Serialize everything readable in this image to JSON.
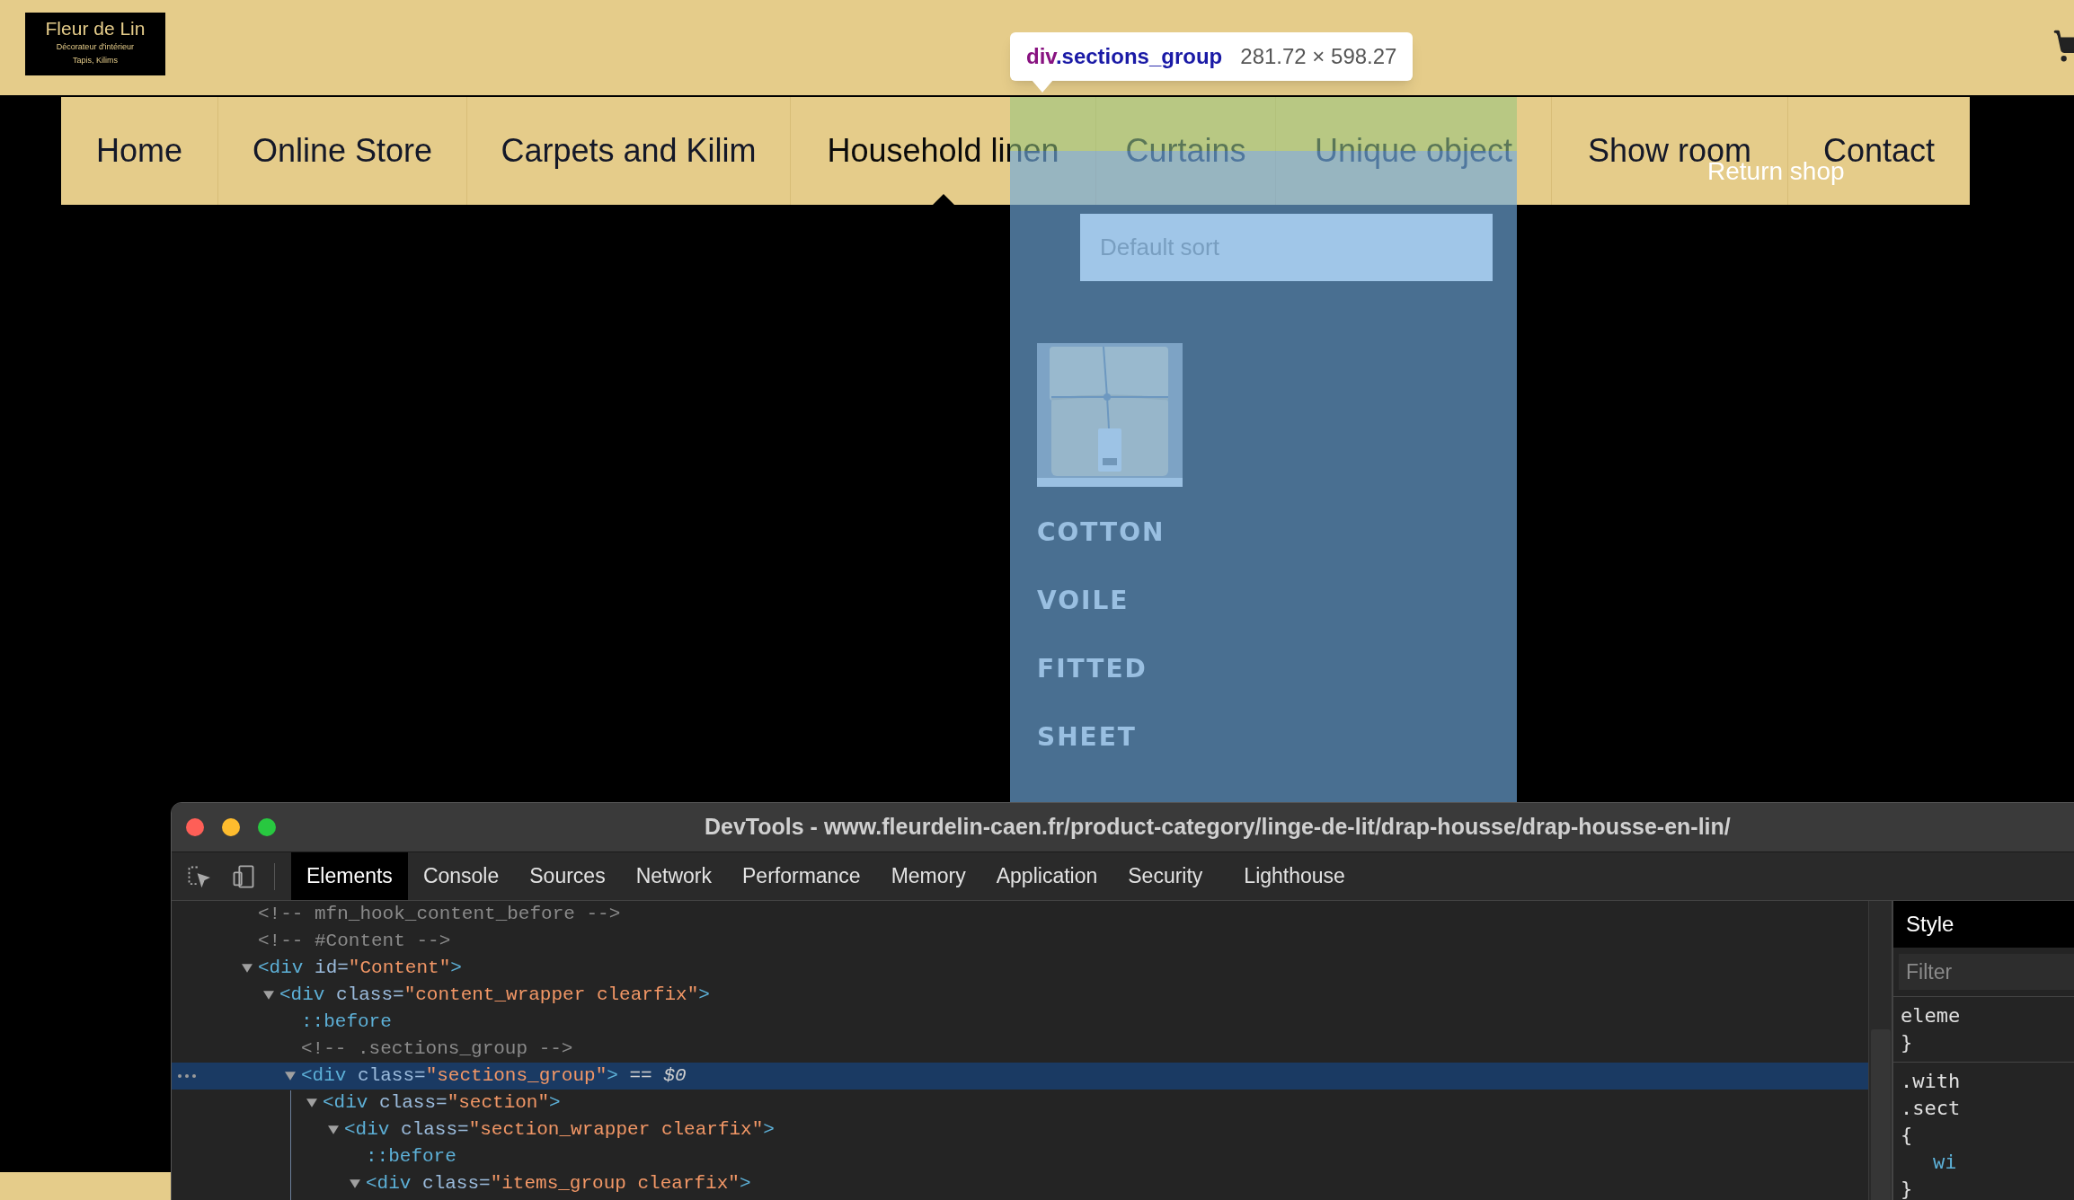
{
  "logo": {
    "title": "Fleur de Lin",
    "lines": [
      "Décorateur d'intérieur",
      "Tapis, Kilims"
    ]
  },
  "nav": {
    "items": [
      {
        "label": "Home",
        "selected": false
      },
      {
        "label": "Online Store",
        "selected": false
      },
      {
        "label": "Carpets and Kilim",
        "selected": false
      },
      {
        "label": "Household linen",
        "selected": true
      },
      {
        "label": "Curtains",
        "selected": false
      },
      {
        "label": "Unique object",
        "selected": false
      },
      {
        "label": "Show room",
        "selected": false
      },
      {
        "label": "Contact",
        "selected": false
      }
    ],
    "return_link": "Return shop"
  },
  "tooltip": {
    "tag": "div",
    "selector": ".sections_group",
    "size": "281.72 × 598.27"
  },
  "content": {
    "sort": {
      "value": "Default sort"
    },
    "product": {
      "title": "COTTON VOILE FITTED SHEET"
    }
  },
  "devtools": {
    "title": "DevTools - www.fleurdelin-caen.fr/product-category/linge-de-lit/drap-housse/drap-housse-en-lin/",
    "tabs": [
      {
        "label": "Elements",
        "selected": true
      },
      {
        "label": "Console",
        "selected": false
      },
      {
        "label": "Sources",
        "selected": false
      },
      {
        "label": "Network",
        "selected": false
      },
      {
        "label": "Performance",
        "selected": false
      },
      {
        "label": "Memory",
        "selected": false
      },
      {
        "label": "Application",
        "selected": false
      },
      {
        "label": "Security",
        "selected": false
      },
      {
        "label": "Lighthouse",
        "selected": false
      }
    ],
    "dom": [
      {
        "selected": false,
        "tokens": [
          {
            "kind": "comment",
            "text": "<!-- mfn_hook_content_before -->"
          }
        ]
      },
      {
        "selected": false,
        "tokens": [
          {
            "kind": "comment",
            "text": "<!-- #Content -->"
          }
        ]
      },
      {
        "selected": false,
        "expanded": true,
        "tokens": [
          {
            "kind": "tag",
            "text": "<div"
          },
          {
            "kind": "attr",
            "text": " id="
          },
          {
            "kind": "value",
            "text": "\"Content\""
          },
          {
            "kind": "tag",
            "text": ">"
          }
        ],
        "children": [
          {
            "selected": false,
            "expanded": true,
            "tokens": [
              {
                "kind": "tag",
                "text": "<div"
              },
              {
                "kind": "attr",
                "text": " class="
              },
              {
                "kind": "value",
                "text": "\"content_wrapper clearfix\""
              },
              {
                "kind": "tag",
                "text": ">"
              }
            ],
            "children": [
              {
                "selected": false,
                "tokens": [
                  {
                    "kind": "pseudo",
                    "text": "::before"
                  }
                ]
              },
              {
                "selected": false,
                "tokens": [
                  {
                    "kind": "comment",
                    "text": "<!-- .sections_group -->"
                  }
                ]
              },
              {
                "selected": true,
                "expanded": true,
                "tokens": [
                  {
                    "kind": "tag",
                    "text": "<div"
                  },
                  {
                    "kind": "attr",
                    "text": " class="
                  },
                  {
                    "kind": "value",
                    "text": "\"sections_group\""
                  },
                  {
                    "kind": "tag",
                    "text": ">"
                  },
                  {
                    "kind": "marker",
                    "text": " == "
                  },
                  {
                    "kind": "var",
                    "text": "$0"
                  }
                ],
                "children": [
                  {
                    "selected": false,
                    "expanded": true,
                    "tokens": [
                      {
                        "kind": "tag",
                        "text": "<div"
                      },
                      {
                        "kind": "attr",
                        "text": " class="
                      },
                      {
                        "kind": "value",
                        "text": "\"section\""
                      },
                      {
                        "kind": "tag",
                        "text": ">"
                      }
                    ],
                    "children": [
                      {
                        "selected": false,
                        "expanded": true,
                        "tokens": [
                          {
                            "kind": "tag",
                            "text": "<div"
                          },
                          {
                            "kind": "attr",
                            "text": " class="
                          },
                          {
                            "kind": "value",
                            "text": "\"section_wrapper clearfix\""
                          },
                          {
                            "kind": "tag",
                            "text": ">"
                          }
                        ],
                        "children": [
                          {
                            "selected": false,
                            "tokens": [
                              {
                                "kind": "pseudo",
                                "text": "::before"
                              }
                            ]
                          },
                          {
                            "selected": false,
                            "expanded": true,
                            "tokens": [
                              {
                                "kind": "tag",
                                "text": "<div"
                              },
                              {
                                "kind": "attr",
                                "text": " class="
                              },
                              {
                                "kind": "value",
                                "text": "\"items_group clearfix\""
                              },
                              {
                                "kind": "tag",
                                "text": ">"
                              }
                            ]
                          }
                        ]
                      }
                    ]
                  }
                ]
              }
            ]
          }
        ]
      }
    ],
    "styles": {
      "title": "Style",
      "filter_placeholder": "Filter",
      "rules": [
        {
          "lines": [
            {
              "kind": "selector",
              "text": "eleme"
            },
            {
              "kind": "brace",
              "text": "}"
            }
          ]
        },
        {
          "lines": [
            {
              "kind": "selector",
              "text": ".with"
            },
            {
              "kind": "selector",
              "text": ".sect"
            },
            {
              "kind": "brace",
              "text": "{"
            },
            {
              "kind": "property",
              "text": "wi"
            },
            {
              "kind": "brace",
              "text": "}"
            }
          ]
        }
      ]
    }
  }
}
